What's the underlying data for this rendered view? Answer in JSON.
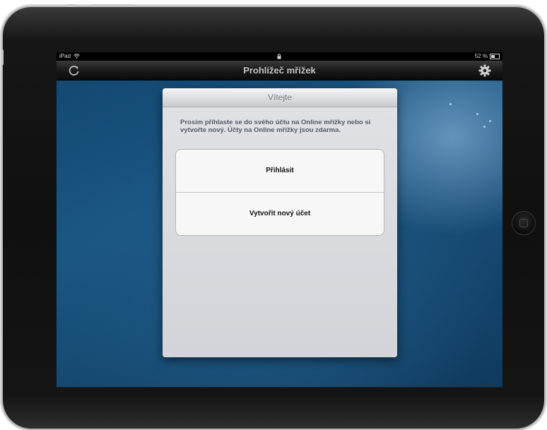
{
  "status_bar": {
    "device_label": "iPad",
    "battery_percent": "52 %",
    "battery_level": 0.52
  },
  "nav_bar": {
    "title": "Prohlížeč mřížek",
    "left_icon": "refresh-icon",
    "right_icon": "gear-icon"
  },
  "modal": {
    "title": "Vítejte",
    "message": "Prosím přihlaste se do svého účtu na Online mřížky nebo si vytvořte nový. Účty na Online mřížky jsou zdarma.",
    "buttons": [
      {
        "label": "Přihlásit"
      },
      {
        "label": "Vytvořit nový účet"
      }
    ]
  },
  "colors": {
    "wallpaper": "#1b5682",
    "nav_bar": "#1a1a1a",
    "modal_background": "#d4d6db",
    "modal_text": "#4f5561"
  }
}
